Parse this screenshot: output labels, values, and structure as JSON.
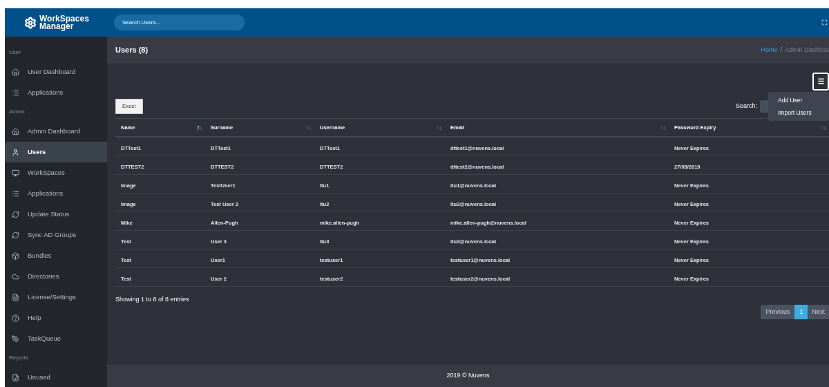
{
  "header": {
    "logo": "WorkSpaces Manager",
    "search": {
      "placeholder": "Search Users..."
    }
  },
  "sidebar": {
    "sections": [
      {
        "title": "User",
        "items": [
          {
            "label": "User Dashboard",
            "selected": false
          },
          {
            "label": "Applications",
            "selected": false
          }
        ]
      },
      {
        "title": "Admin",
        "items": [
          {
            "label": "Admin Dashboard",
            "selected": false
          },
          {
            "label": "Users",
            "selected": true
          },
          {
            "label": "WorkSpaces",
            "selected": false
          },
          {
            "label": "Applications",
            "selected": false
          },
          {
            "label": "Update Status",
            "selected": false
          },
          {
            "label": "Sync AD Groups",
            "selected": false
          },
          {
            "label": "Bundles",
            "selected": false
          },
          {
            "label": "Directories",
            "selected": false
          },
          {
            "label": "License/Settings",
            "selected": false
          },
          {
            "label": "Help",
            "selected": false
          },
          {
            "label": "TaskQueue",
            "selected": false
          }
        ]
      },
      {
        "title": "Reports",
        "items": [
          {
            "label": "Unused",
            "selected": false
          }
        ]
      }
    ]
  },
  "page": {
    "title": "Users (8)",
    "breadcrumb": [
      {
        "label": "Home",
        "kind": "link"
      },
      {
        "label": "/",
        "kind": "separator"
      },
      {
        "label": "Admin Dashboa",
        "kind": "current"
      }
    ]
  },
  "toolbar": {
    "export_button": "Excel",
    "search_label": "Search:",
    "menu": {
      "expanded": true,
      "items": [
        "Add User",
        "Import Users"
      ]
    }
  },
  "table": {
    "columns": [
      {
        "label": "Name",
        "sorted": true
      },
      {
        "label": "Surname",
        "sorted": false
      },
      {
        "label": "Username",
        "sorted": false
      },
      {
        "label": "Email",
        "sorted": false
      },
      {
        "label": "Password Expiry",
        "sorted": false
      }
    ],
    "rows": [
      [
        "DTTest1",
        "DTTest1",
        "DTTest1",
        "dttest1@nuvens.local",
        "Never Expires"
      ],
      [
        "DTTEST2",
        "DTTEST2",
        "DTTEST2",
        "dttest2@nuvens.local",
        "27/05/2019"
      ],
      [
        "Image",
        "TestUser1",
        "itu1",
        "itu1@nuvens.local",
        "Never Expires"
      ],
      [
        "Image",
        "Test User 2",
        "itu2",
        "itu2@nuvens.local",
        "Never Expires"
      ],
      [
        "Mike",
        "Allen-Pugh",
        "mike.allen-pugh",
        "mike.allen-pugh@nuvens.local",
        "Never Expires"
      ],
      [
        "Test",
        "User 3",
        "itu3",
        "itu3@nuvens.local",
        "Never Expires"
      ],
      [
        "Test",
        "User1",
        "testuser1",
        "testuser1@nuvens.local",
        "Never Expires"
      ],
      [
        "Test",
        "User 2",
        "testuser2",
        "testuser2@nuvens.local",
        "Never Expires"
      ]
    ]
  },
  "info": "Showing 1 to 8 of 8 entries",
  "pagination": {
    "previous": "Previous",
    "pages": [
      {
        "label": "1",
        "selected": true
      }
    ],
    "next": "Next"
  },
  "footer": "2019 © Nuvens"
}
